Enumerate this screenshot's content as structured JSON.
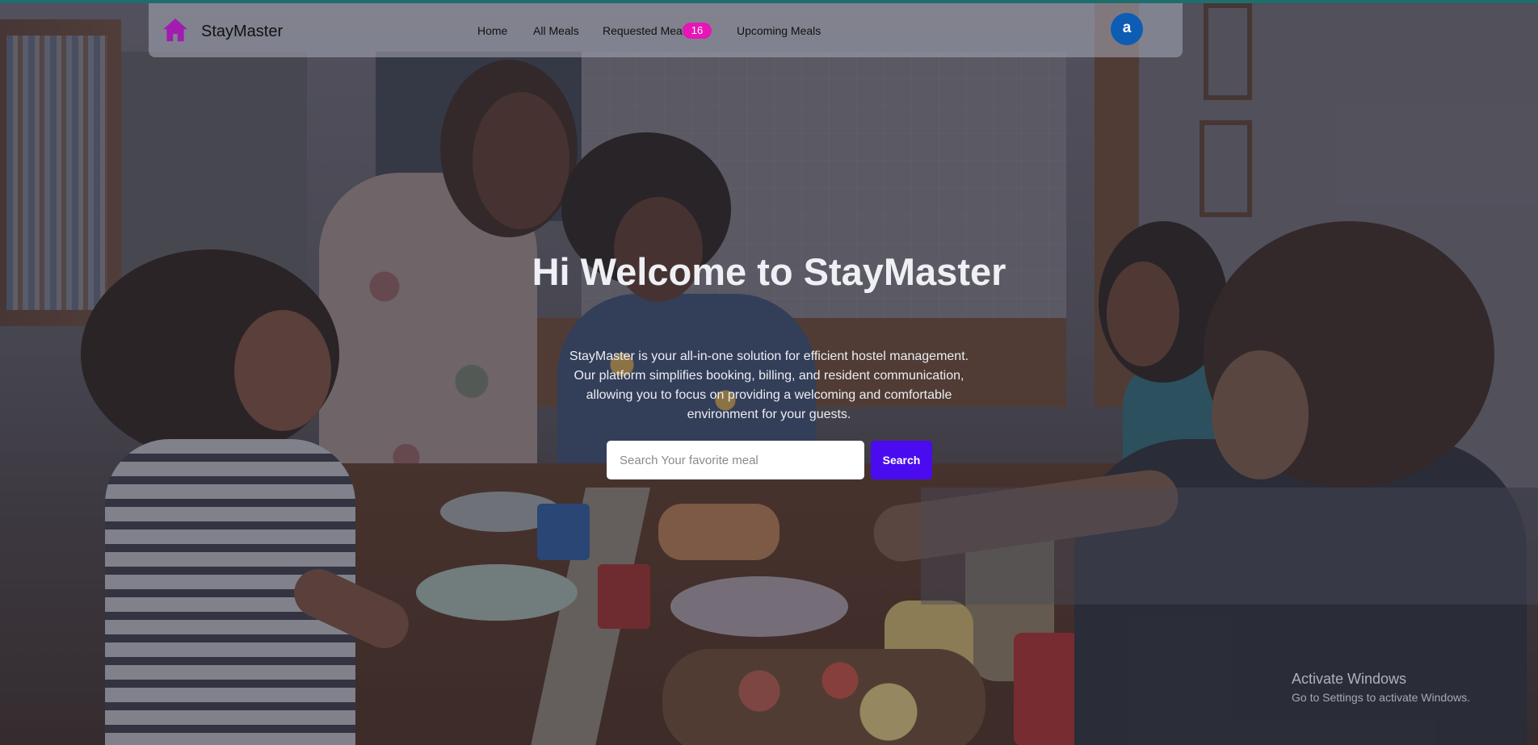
{
  "brand": {
    "name": "StayMaster",
    "logo_icon": "home-icon",
    "logo_color": "#a21caf"
  },
  "nav": {
    "links": [
      {
        "label": "Home"
      },
      {
        "label": "All Meals"
      },
      {
        "label": "Requested Meal"
      },
      {
        "label": "Upcoming Meals"
      }
    ],
    "requested_badge": "16",
    "badge_color": "#e616b7"
  },
  "user": {
    "avatar_initial": "a",
    "avatar_color": "#0c5db3"
  },
  "hero": {
    "title": "Hi Welcome to StayMaster",
    "description": "StayMaster is your all-in-one solution for efficient hostel management. Our platform simplifies booking, billing, and resident communication, allowing you to focus on providing a welcoming and comfortable environment for your guests."
  },
  "search": {
    "placeholder": "Search Your favorite meal",
    "value": "",
    "button_label": "Search",
    "button_color": "#4a0bf0"
  },
  "watermark": {
    "title": "Activate Windows",
    "subtitle": "Go to Settings to activate Windows."
  }
}
